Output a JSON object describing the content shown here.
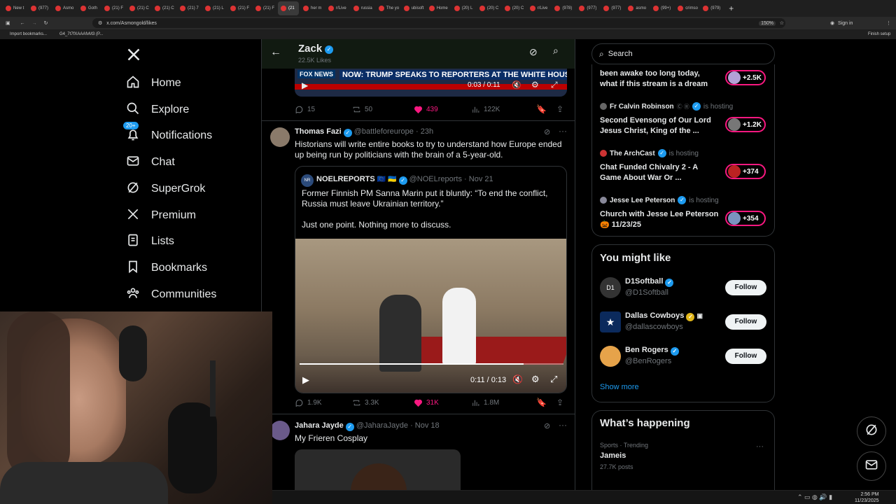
{
  "browser": {
    "tabs": [
      "New t",
      "(977)",
      "Asmo",
      "Goth",
      "(21) F",
      "(21) C",
      "(21) C",
      "(21) 7",
      "(21) L",
      "(21) F",
      "(21) F",
      "(21",
      "her m",
      "r/Live",
      "russia",
      "The yo",
      "ubisoft",
      "Home",
      "(20) L",
      "(20) C",
      "(20) C",
      "r/Live",
      "(978)",
      "(977)",
      "(977)",
      "asmo",
      "(99+)",
      "crimso",
      "(979)"
    ],
    "url": "x.com/Asmongold/likes",
    "zoom": "150%",
    "signin": "Sign in",
    "finish_setup": "Finish setup",
    "bookmarks": [
      "Import bookmarks...",
      "G4_7t7fXAAAfvM3 (P..."
    ]
  },
  "nav": {
    "home": "Home",
    "explore": "Explore",
    "notifications": "Notifications",
    "notif_badge": "20+",
    "chat": "Chat",
    "supergrok": "SuperGrok",
    "premium": "Premium",
    "lists": "Lists",
    "bookmarks": "Bookmarks",
    "communities": "Communities"
  },
  "header": {
    "name": "Zack",
    "likes": "22.5K Likes"
  },
  "post1": {
    "video_headline": "NOW: TRUMP SPEAKS TO REPORTERS AT THE WHITE HOUSE",
    "video_brand": "FOX NEWS",
    "video_time": "0:03 / 0:11",
    "replies": "15",
    "reposts": "50",
    "likes": "439",
    "views": "122K"
  },
  "post2": {
    "author": "Thomas Fazi",
    "handle": "@battleforeurope",
    "time": "23h",
    "text": "Historians will write entire books to try to understand how Europe ended up being run by politicians with the brain of a 5-year-old.",
    "quote": {
      "author": "NOELREPORTS",
      "flags": "🇪🇺 🇺🇦",
      "handle": "@NOELreports",
      "date": "Nov 21",
      "text1": "Former Finnish PM Sanna Marin put it bluntly: “To end the conflict, Russia must leave Ukrainian territory.”",
      "text2": "Just one point. Nothing more to discuss.",
      "video_time": "0:11 / 0:13",
      "progress": 0.85
    },
    "replies": "1.9K",
    "reposts": "3.3K",
    "likes": "31K",
    "views": "1.8M"
  },
  "post3": {
    "author": "Jahara Jayde",
    "handle": "@JaharaJayde",
    "date": "Nov 18",
    "text": "My Frieren Cosplay"
  },
  "search": {
    "placeholder": "Search"
  },
  "spaces": [
    {
      "title": "been awake too long today, what if this stream is a dream",
      "count": "+2.5K"
    },
    {
      "host": "Fr Calvin Robinson",
      "hosting": "is hosting",
      "title": "Second Evensong of Our Lord Jesus Christ, King of the ...",
      "count": "+1.2K"
    },
    {
      "host": "The ArchCast",
      "hosting": "is hosting",
      "title": "Chat Funded Chivalry 2 - A Game About War Or ...",
      "count": "+374"
    },
    {
      "host": "Jesse Lee Peterson",
      "hosting": "is hosting",
      "title": "Church with Jesse Lee Peterson 🎃 11/23/25",
      "count": "+354"
    }
  ],
  "you_might_like": {
    "title": "You might like",
    "accounts": [
      {
        "name": "D1Softball",
        "handle": "@D1Softball",
        "button": "Follow"
      },
      {
        "name": "Dallas Cowboys",
        "handle": "@dallascowboys",
        "button": "Follow"
      },
      {
        "name": "Ben Rogers",
        "handle": "@BenRogers",
        "button": "Follow"
      }
    ],
    "show_more": "Show more"
  },
  "whats_happening": {
    "title": "What’s happening",
    "trend_context": "Sports · Trending",
    "trend_name": "Jameis",
    "trend_posts": "27.7K posts"
  },
  "clock": {
    "time": "2:56 PM",
    "date": "11/23/2025"
  },
  "colors": {
    "accent": "#1d9bf0",
    "like": "#f91880",
    "border": "#2f3336",
    "muted": "#71767b"
  }
}
